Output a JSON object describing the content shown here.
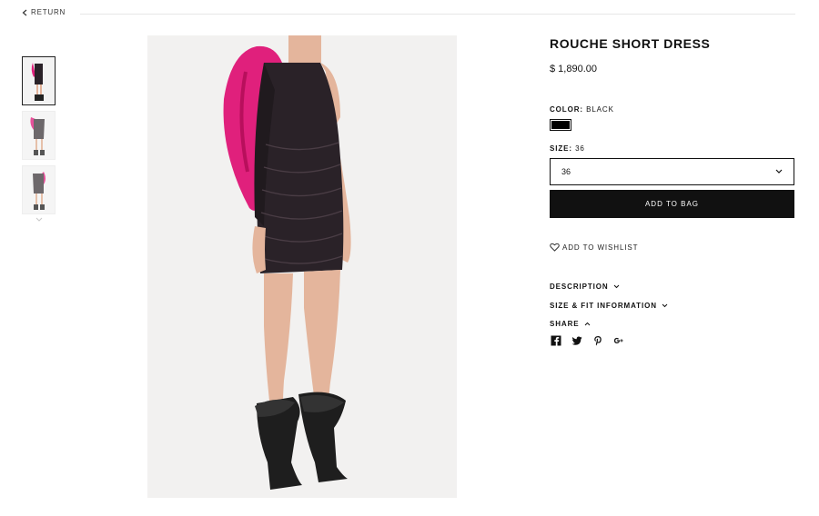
{
  "nav": {
    "return_label": "RETURN"
  },
  "product": {
    "title": "ROUCHE SHORT DRESS",
    "price": "$ 1,890.00",
    "color_label": "COLOR:",
    "color_value": "BLACK",
    "swatch_color": "#000000",
    "size_label": "SIZE:",
    "size_value": "36",
    "size_selected": "36",
    "add_to_bag": "ADD TO BAG",
    "wishlist": "ADD TO WISHLIST"
  },
  "accordions": {
    "description": "DESCRIPTION",
    "size_fit": "SIZE & FIT INFORMATION",
    "share": "SHARE"
  },
  "social_icons": [
    "facebook-icon",
    "twitter-icon",
    "pinterest-icon",
    "google-plus-icon"
  ],
  "colors": {
    "accent_pink": "#e0207c",
    "dress": "#2a2228",
    "button": "#111111"
  }
}
